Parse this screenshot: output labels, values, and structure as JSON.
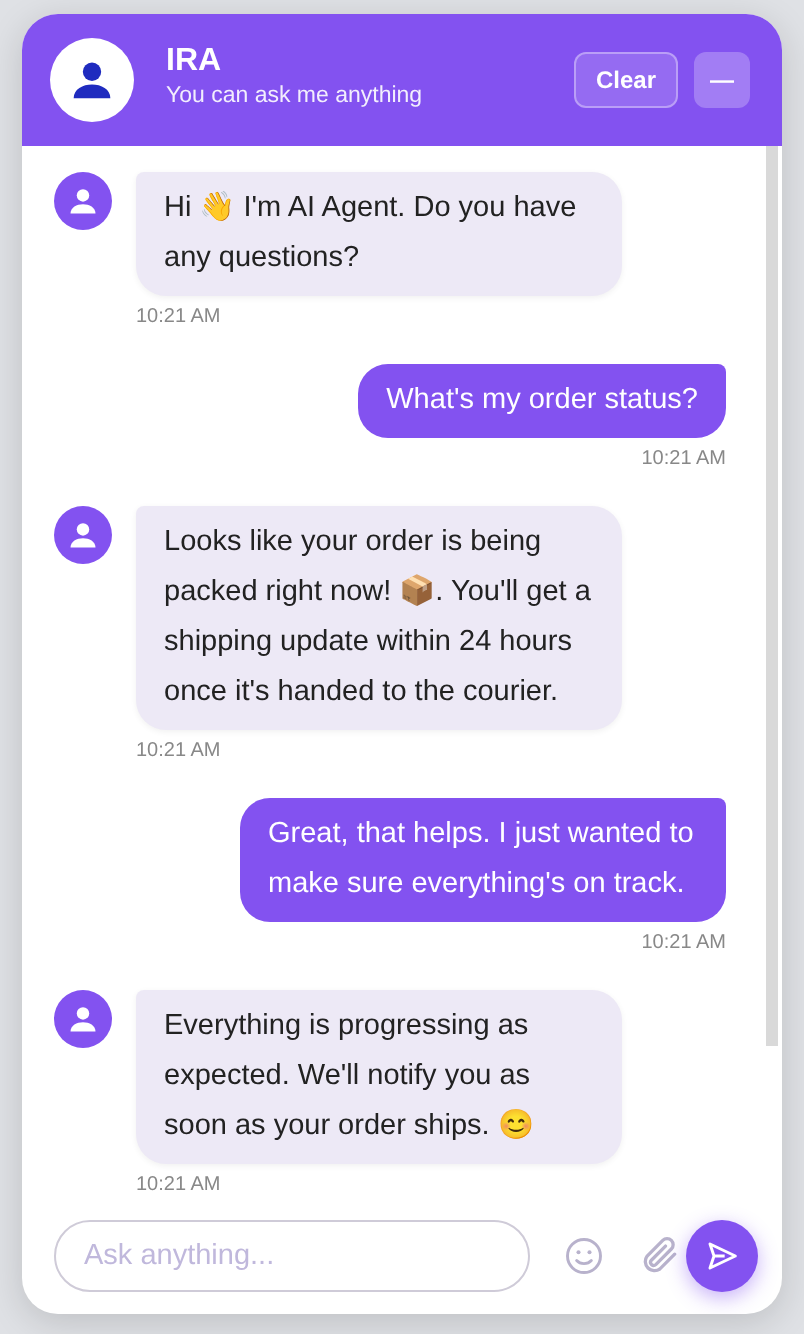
{
  "header": {
    "title": "IRA",
    "subtitle": "You can ask me anything",
    "buttons": [
      {
        "kind": "clear",
        "label": "Clear"
      },
      {
        "kind": "minimize",
        "label": "—"
      }
    ]
  },
  "messages": [
    {
      "kind": "bot",
      "text": "Hi 👋 I'm AI Agent. Do you have any questions?",
      "time": "10:21 AM"
    },
    {
      "kind": "user",
      "text": "What's my order status?",
      "time": "10:21 AM"
    },
    {
      "kind": "bot",
      "text": "Looks like your order is being packed right now! 📦. You'll get a shipping update within 24 hours once it's handed to the courier.",
      "time": "10:21 AM"
    },
    {
      "kind": "user",
      "text": "Great, that helps. I just wanted to make sure everything's on track.",
      "time": "10:21 AM"
    },
    {
      "kind": "bot",
      "text": "Everything is progressing as expected. We'll notify you as soon as your order ships. 😊",
      "time": "10:21 AM"
    }
  ],
  "composer": {
    "placeholder": "Ask anything..."
  }
}
